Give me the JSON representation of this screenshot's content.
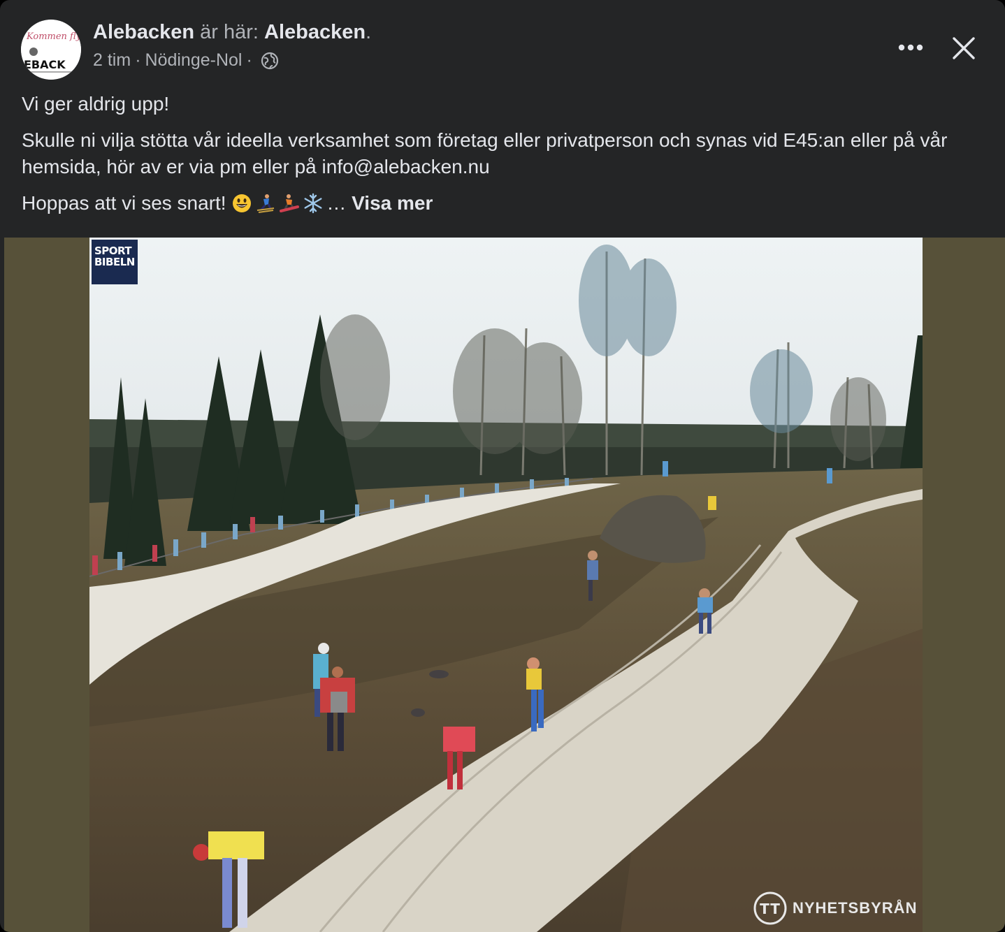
{
  "post": {
    "author": "Alebacken",
    "is_at": "är här:",
    "place": "Alebacken",
    "place_suffix": ".",
    "time": "2 tim",
    "dot1": "·",
    "location": "Nödinge-Nol",
    "dot2": "·",
    "privacy_icon": "globe-icon",
    "paragraphs": {
      "p1": "Vi ger aldrig upp!",
      "p2": "Skulle ni vilja stötta vår ideella verksamhet som företag eller privatperson och synas vid E45:an eller på vår hemsida, hör av er via pm eller på info@alebacken.nu",
      "p3": "Hoppas att vi ses snart!",
      "ellipsis": "…",
      "see_more": "Visa mer"
    },
    "emojis": [
      "grinning-face",
      "skier",
      "snowboarder",
      "snowflake"
    ]
  },
  "avatar": {
    "script_text": "Kommen fly",
    "logo_text": "EBACK"
  },
  "header_actions": {
    "more_icon": "more-horizontal-icon",
    "close_icon": "close-icon"
  },
  "photo": {
    "watermark_top": {
      "line1": "SPORT",
      "line2": "BIBELN"
    },
    "watermark_bottom": "NYHETSBYRÅN",
    "watermark_logo": "TT"
  },
  "colors": {
    "background": "#242526",
    "text_primary": "#e4e6eb",
    "text_secondary": "#b0b3b8",
    "media_letterbox": "#575139"
  }
}
